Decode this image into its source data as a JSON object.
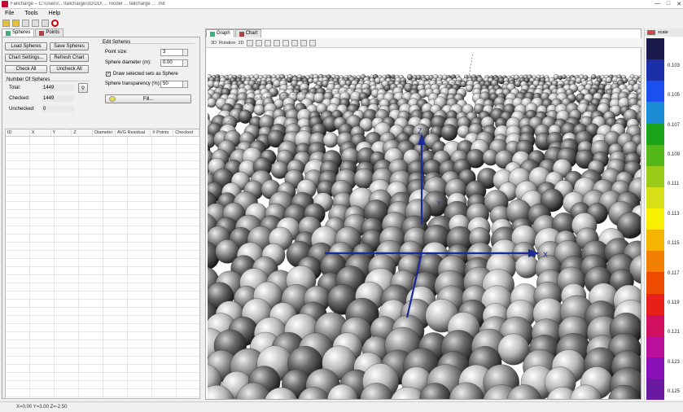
{
  "window": {
    "title": "Fallcharge – C:\\Users\\...\\fallcharge\\3D\\2D\\ ... model ... fallcharge ... .mit",
    "minimize": "—",
    "maximize": "□",
    "close": "✕"
  },
  "menu": [
    "File",
    "Tools",
    "Help"
  ],
  "left_tabs": [
    {
      "label": "Spheres"
    },
    {
      "label": "Points"
    }
  ],
  "buttons": {
    "load_spheres": "Load Spheres",
    "save_spheres": "Save Spheres",
    "chart_settings": "Chart Settings...",
    "refresh_chart": "Refresh Chart",
    "check_all": "Check All",
    "uncheck_all": "Uncheck All",
    "fill": "Fill..."
  },
  "edit_spheres": {
    "heading": "Edit Spheres",
    "point_size_label": "Point size:",
    "point_size_value": "3",
    "sphere_diameter_label": "Sphere diameter (m):",
    "sphere_diameter_value": "0.00",
    "draw_selected_label": "Draw selected sets as Sphere",
    "draw_selected_checked": true,
    "transparency_label": "Sphere transparency (%):",
    "transparency_value": "50"
  },
  "number_of_spheres": {
    "heading": "Number Of Spheres",
    "total_label": "Total:",
    "total_value": "1449",
    "checked_label": "Checked:",
    "checked_value": "1449",
    "unchecked_label": "Unchecked:",
    "unchecked_value": "0"
  },
  "grid_columns": [
    "ID",
    "X",
    "Y",
    "Z",
    "Diameter",
    "AVG Residual",
    "# Points",
    "Checked"
  ],
  "viewer_tabs": [
    {
      "label": "Graph"
    },
    {
      "label": "Chart"
    }
  ],
  "viewer_toolbar": [
    "3D",
    "Rotation",
    "2D"
  ],
  "legend": {
    "header": "scale",
    "colors": [
      "#1a1a4d",
      "#1a2fa8",
      "#1b4ff0",
      "#1c8bd6",
      "#1aa31a",
      "#55b81a",
      "#9acb1a",
      "#d8e01a",
      "#f7f000",
      "#f4b400",
      "#f28000",
      "#ee4a00",
      "#e8201a",
      "#d21060",
      "#b8109a",
      "#8a10b8",
      "#6a1aa0"
    ],
    "ticks": [
      "0.103",
      "0.105",
      "0.107",
      "0.109",
      "0.111",
      "0.113",
      "0.115",
      "0.117",
      "0.119",
      "0.121",
      "0.123",
      "0.125"
    ]
  },
  "axes_labels": {
    "x": "X",
    "y": "Y",
    "z": "Z"
  },
  "status": "X=0.00 Y=3.00 Z=-2.50"
}
